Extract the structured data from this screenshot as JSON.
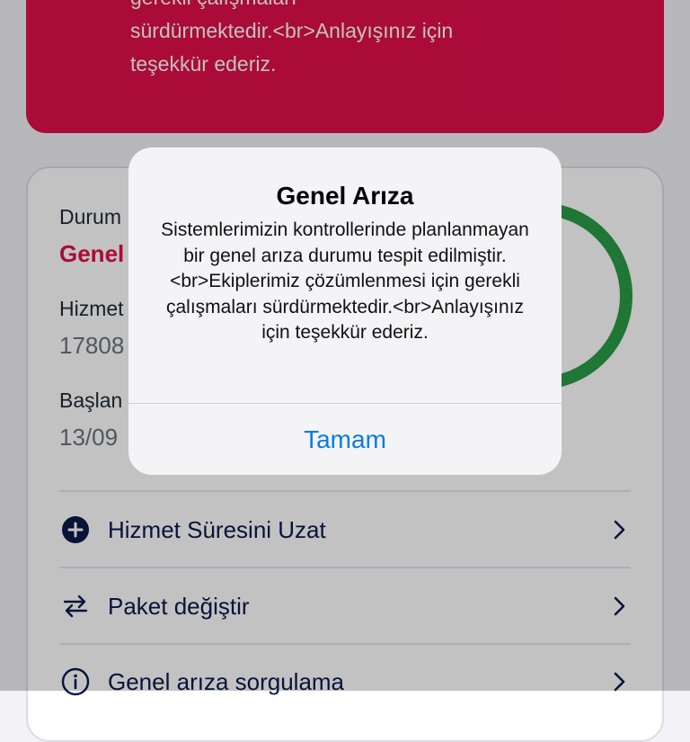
{
  "banner": {
    "text": "edilmiştir.<br>Ekiplerimiz çözümlenmesi için\ngerekli çalışmaları\nsürdürmektedir.<br>Anlayışınız için\nteşekkür ederiz.",
    "icon": "exclamation-icon",
    "color": "#e00f49"
  },
  "card": {
    "status_label": "Durum",
    "status_value": "Genel",
    "service_label": "Hizmet",
    "service_value": "17808",
    "start_label": "Başlan",
    "start_value": "13/09",
    "gauge_value": "5",
    "gauge_color": "#2a9c46",
    "actions": [
      {
        "label": "Hizmet Süresini Uzat",
        "icon": "plus-circle-icon"
      },
      {
        "label": "Paket değiştir",
        "icon": "swap-arrows-icon"
      },
      {
        "label": "Genel arıza sorgulama",
        "icon": "info-circle-icon"
      }
    ]
  },
  "alert": {
    "title": "Genel Arıza",
    "message": "Sistemlerimizin kontrollerinde planlanmayan bir genel arıza durumu tespit edilmiştir.<br>Ekiplerimiz çözümlenmesi için gerekli çalışmaları sürdürmektedir.<br>Anlayışınız için teşekkür ederiz.",
    "ok_label": "Tamam",
    "accent": "#0a7ae6"
  }
}
